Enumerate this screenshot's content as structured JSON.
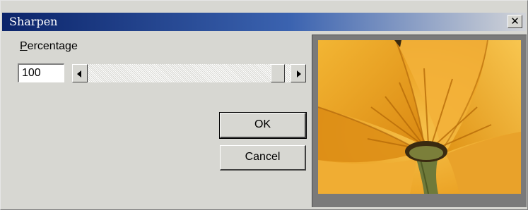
{
  "window": {
    "title": "Sharpen",
    "close_glyph": "✕"
  },
  "percentage": {
    "label_mnemonic": "P",
    "label_rest": "ercentage",
    "value": "100"
  },
  "scrollbar": {
    "left_arrow_icon": "arrow-left-icon",
    "right_arrow_icon": "arrow-right-icon",
    "level_percent": 100
  },
  "buttons": {
    "ok_label": "OK",
    "cancel_label": "Cancel"
  },
  "preview": {
    "image_subject": "orange-flower",
    "colors": {
      "petal_light": "#f4b73a",
      "petal_mid": "#e89a1a",
      "petal_dark": "#c8780c",
      "stem": "#6f7a3a",
      "center": "#3a2a10"
    }
  },
  "colors": {
    "dialog_bg": "#d7d7d2",
    "title_start": "#0b246a",
    "title_end": "#d2d4d8"
  }
}
